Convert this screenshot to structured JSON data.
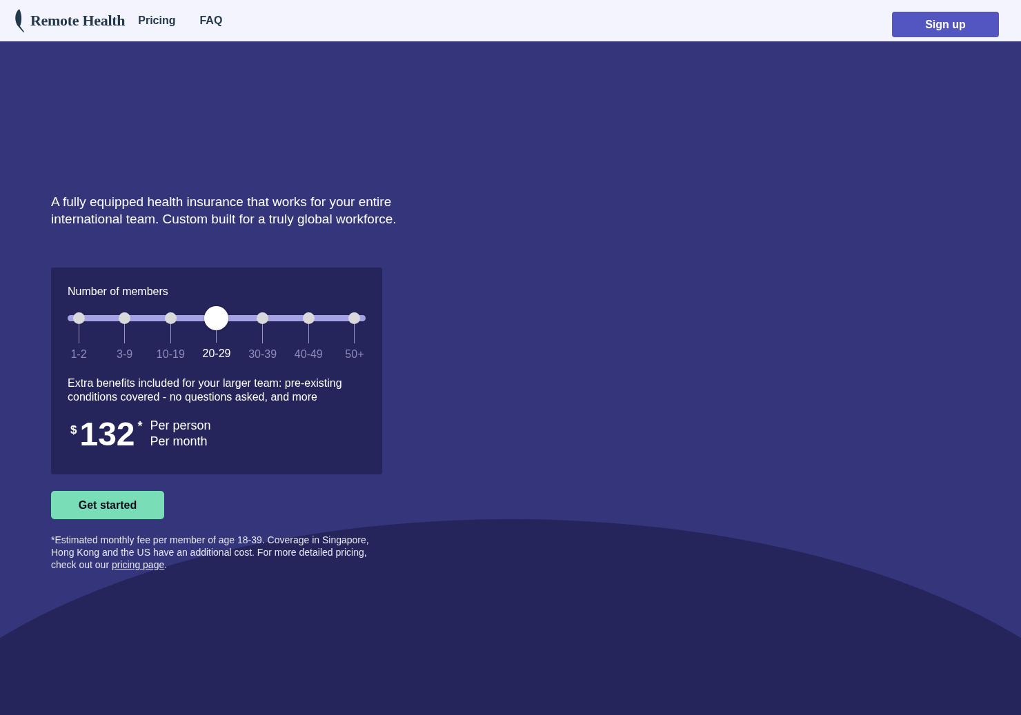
{
  "header": {
    "brand": "Remote Health",
    "nav": [
      "Pricing",
      "FAQ"
    ],
    "signup": "Sign up"
  },
  "hero": {
    "tagline": "A fully equipped health insurance that works for your entire international team. Custom built for a truly global workforce."
  },
  "calculator": {
    "label": "Number of members",
    "slider": {
      "level": 0.5
    },
    "stops": [
      {
        "label": "1-2",
        "selected": false
      },
      {
        "label": "3-9",
        "selected": false
      },
      {
        "label": "10-19",
        "selected": false
      },
      {
        "label": "20-29",
        "selected": true
      },
      {
        "label": "30-39",
        "selected": false
      },
      {
        "label": "40-49",
        "selected": false
      },
      {
        "label": "50+",
        "selected": false
      }
    ],
    "benefits": "Extra benefits included for your larger team: pre-existing conditions covered - no questions asked, and more",
    "currency": "$",
    "price": "132",
    "asterisk": "*",
    "per": [
      "Per person",
      "Per month"
    ]
  },
  "cta": "Get started",
  "footnote": {
    "text": "*Estimated monthly fee per member of age 18-39. Coverage in Singapore, Hong Kong and the US have an additional cost. For more detailed pricing, check out our ",
    "link": "pricing page",
    "end": "."
  }
}
